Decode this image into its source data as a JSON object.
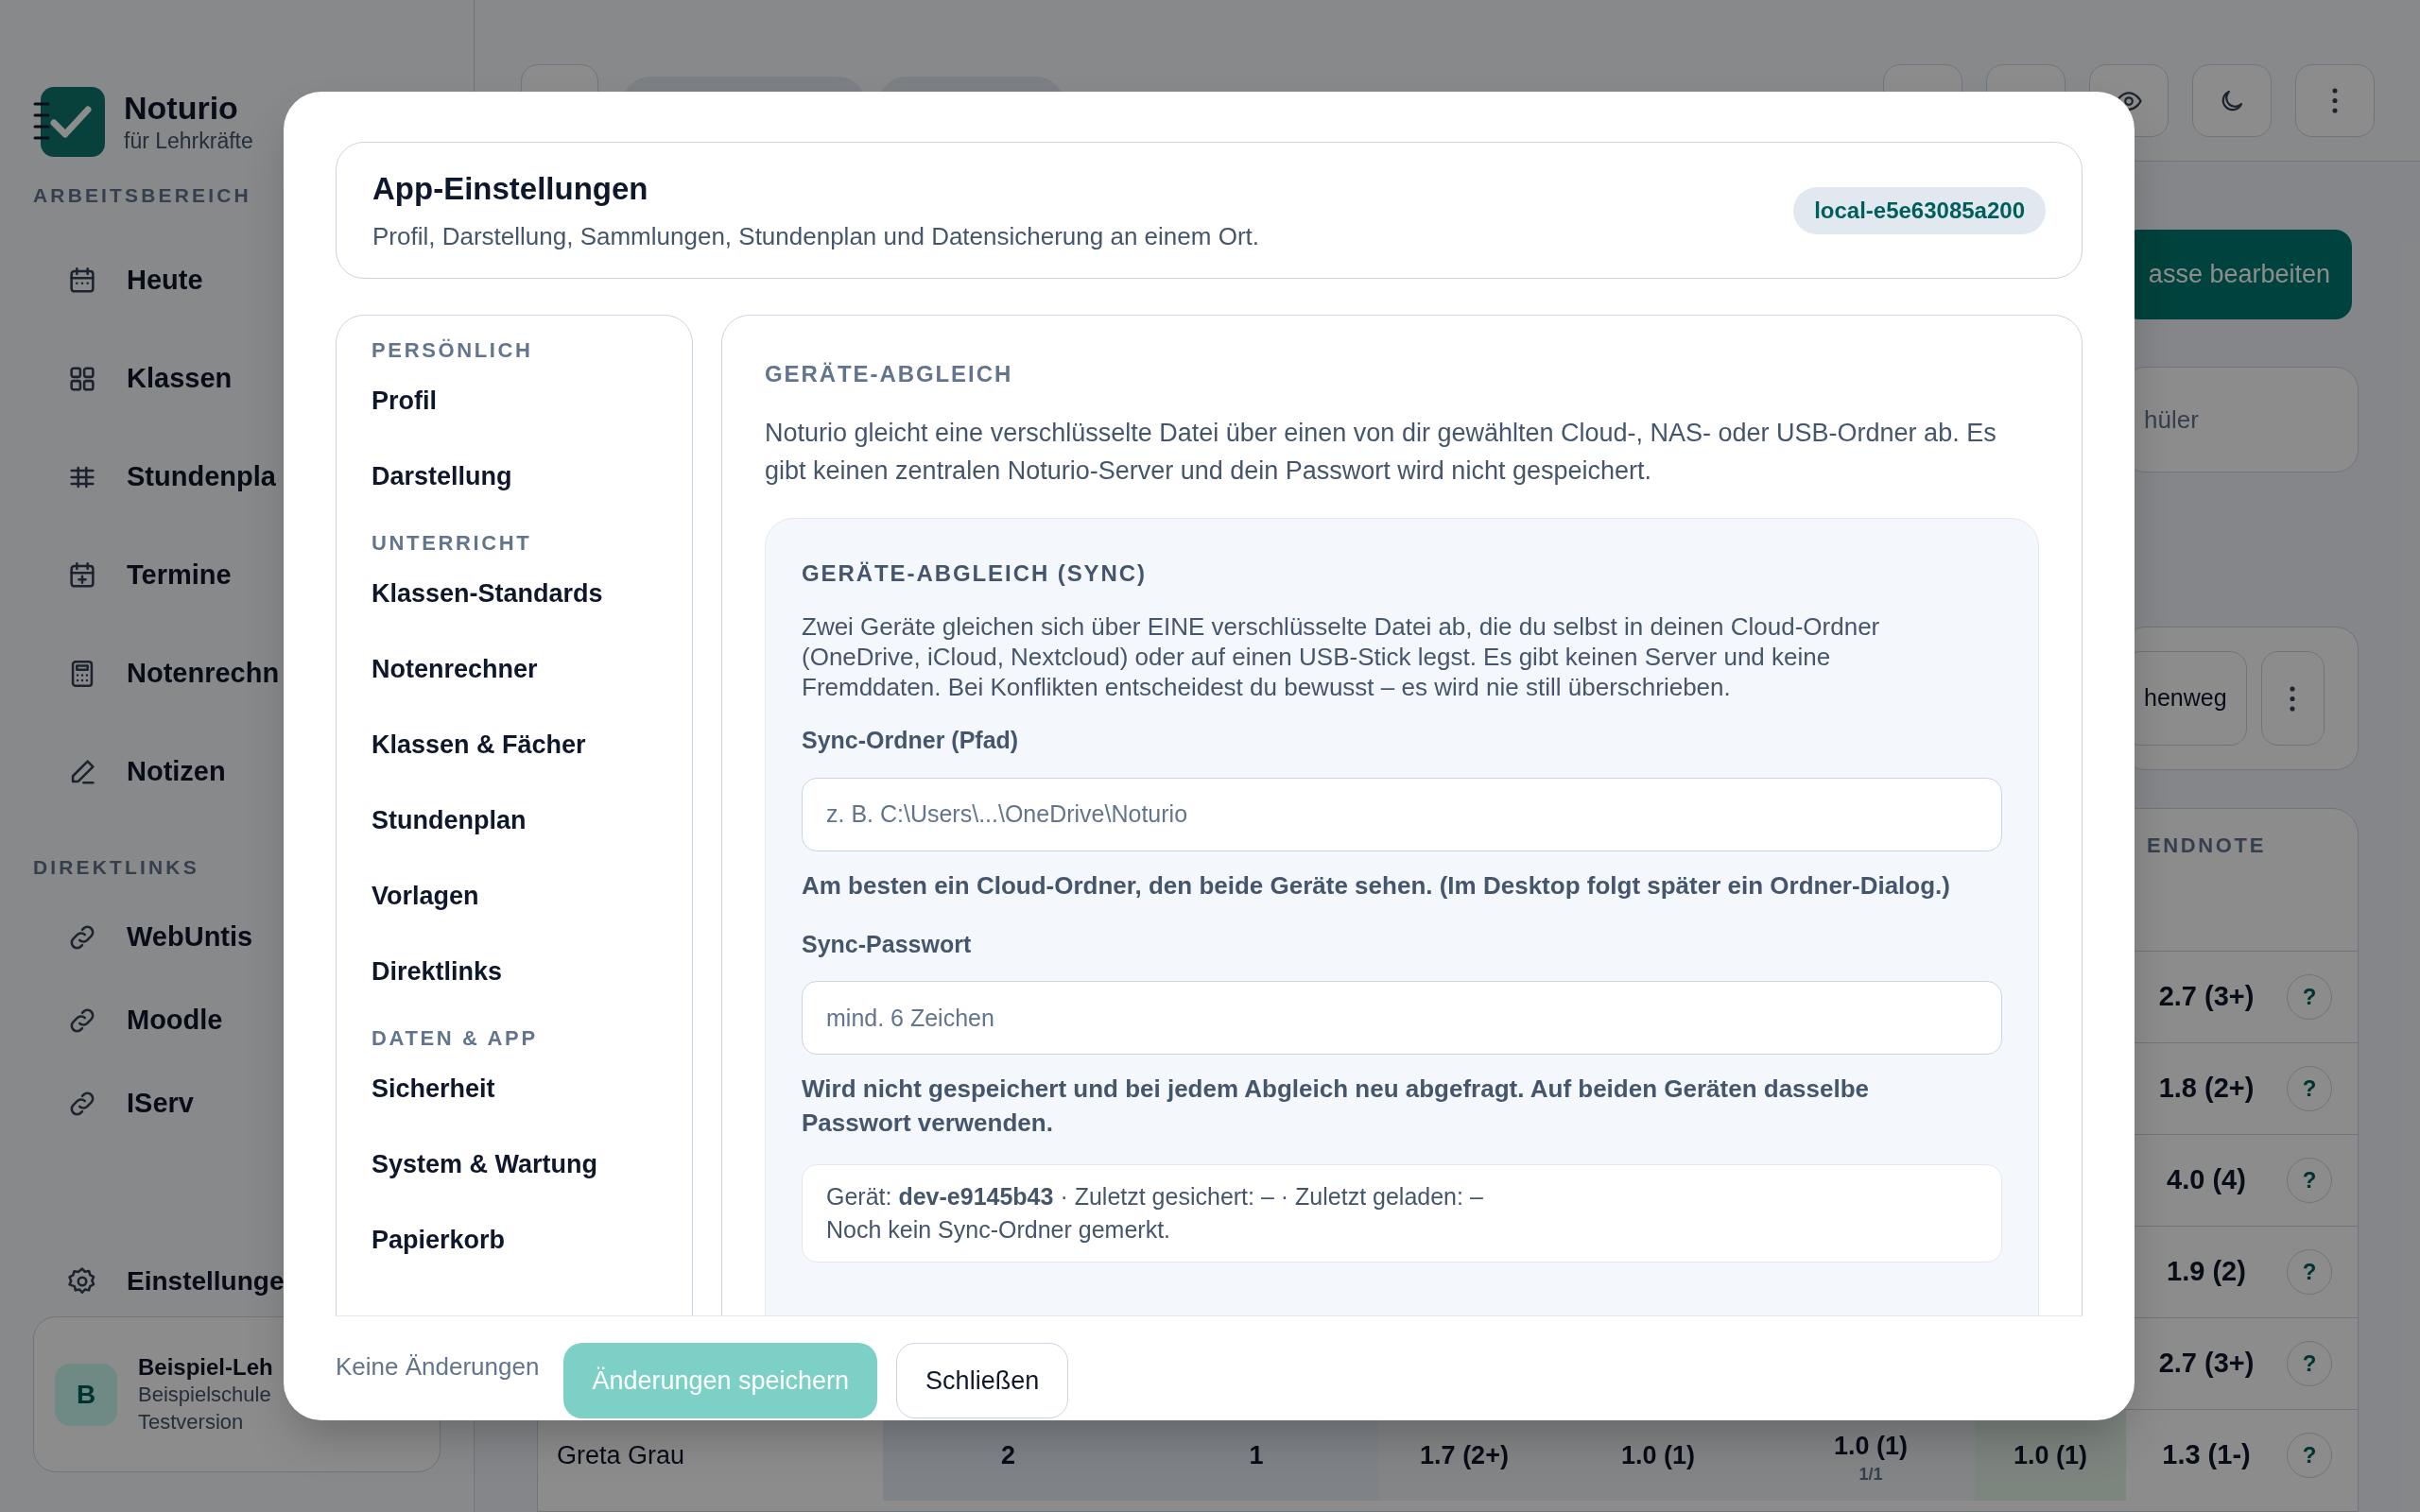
{
  "sidebar": {
    "brand": {
      "name": "Noturio",
      "tagline": "für Lehrkräfte"
    },
    "sections": [
      {
        "label": "ARBEITSBEREICH",
        "items": [
          {
            "label": "Heute"
          },
          {
            "label": "Klassen"
          },
          {
            "label": "Stundenpla"
          },
          {
            "label": "Termine"
          },
          {
            "label": "Notenrechn"
          },
          {
            "label": "Notizen"
          }
        ]
      },
      {
        "label": "DIREKTLINKS",
        "items": [
          {
            "label": "WebUntis"
          },
          {
            "label": "Moodle"
          },
          {
            "label": "IServ"
          }
        ]
      }
    ],
    "settings_item": "Einstellunge",
    "profile": {
      "avatar": "B",
      "name": "Beispiel-Leh",
      "school": "Beispielschule",
      "plan": "Testversion"
    }
  },
  "main": {
    "primary_button": "asse bearbeiten",
    "search_card": "hüler",
    "toolbar_button": "henweg",
    "table": {
      "endnote_header": "ENDNOTE",
      "rows": [
        {
          "endnote": "2.7 (3+)",
          "help": "?"
        },
        {
          "endnote": "1.8 (2+)",
          "help": "?"
        },
        {
          "endnote": "4.0 (4)",
          "help": "?"
        },
        {
          "endnote": "1.9 (2)",
          "help": "?"
        },
        {
          "endnote": "2.7 (3+)",
          "help": "?"
        },
        {
          "name": "Greta Grau",
          "column_2": "2",
          "column_3": "1",
          "column_4": "1.7 (2+)",
          "column_5": "1.0 (1)",
          "column_6": "1.0 (1)",
          "column_6_sub": "1/1",
          "column_7": "1.0 (1)",
          "endnote": "1.3 (1-)",
          "help": "?"
        }
      ]
    }
  },
  "dialog": {
    "title": "App-Einstellungen",
    "subtitle": "Profil, Darstellung, Sammlungen, Stundenplan und Datensicherung an einem Ort.",
    "device_badge": "local-e5e63085a200",
    "nav": [
      {
        "label": "PERSÖNLICH",
        "items": [
          {
            "label": "Profil",
            "selected": false
          },
          {
            "label": "Darstellung",
            "selected": false
          }
        ]
      },
      {
        "label": "UNTERRICHT",
        "items": [
          {
            "label": "Klassen-Standards",
            "selected": false
          },
          {
            "label": "Notenrechner",
            "selected": false
          },
          {
            "label": "Klassen & Fächer",
            "selected": false
          },
          {
            "label": "Stundenplan",
            "selected": false
          },
          {
            "label": "Vorlagen",
            "selected": false
          },
          {
            "label": "Direktlinks",
            "selected": false
          }
        ]
      },
      {
        "label": "DATEN & APP",
        "items": [
          {
            "label": "Sicherheit",
            "selected": false
          },
          {
            "label": "System & Wartung",
            "selected": false
          },
          {
            "label": "Papierkorb",
            "selected": false
          }
        ]
      }
    ],
    "panel": {
      "heading": "GERÄTE-ABGLEICH",
      "intro": "Noturio gleicht eine verschlüsselte Datei über einen von dir gewählten Cloud-, NAS- oder USB-Ordner ab. Es gibt keinen zentralen Noturio-Server und dein Passwort wird nicht gespeichert.",
      "sync": {
        "heading": "GERÄTE-ABGLEICH (SYNC)",
        "description": "Zwei Geräte gleichen sich über EINE verschlüsselte Datei ab, die du selbst in deinen Cloud-Ordner (OneDrive, iCloud, Nextcloud) oder auf einen USB-Stick legst. Es gibt keinen Server und keine Fremddaten. Bei Konflikten entscheidest du bewusst – es wird nie still überschrieben.",
        "fields": [
          {
            "label": "Sync-Ordner (Pfad)",
            "placeholder": "z. B. C:\\Users\\...\\OneDrive\\Noturio",
            "hint": "Am besten ein Cloud-Ordner, den beide Geräte sehen. (Im Desktop folgt später ein Ordner-Dialog.)"
          },
          {
            "label": "Sync-Passwort",
            "placeholder": "mind. 6 Zeichen",
            "hint": "Wird nicht gespeichert und bei jedem Abgleich neu abgefragt. Auf beiden Geräten dasselbe Passwort verwenden."
          }
        ],
        "status": [
          "Gerät: **dev-e9145b43** · Zuletzt gesichert: – · Zuletzt geladen: –",
          "Noch kein Sync-Ordner gemerkt."
        ]
      }
    },
    "footer": {
      "status": "Keine Änderungen",
      "save_button": {
        "label": "Änderungen speichern",
        "disabled": true
      },
      "close_button": "Schließen"
    }
  }
}
